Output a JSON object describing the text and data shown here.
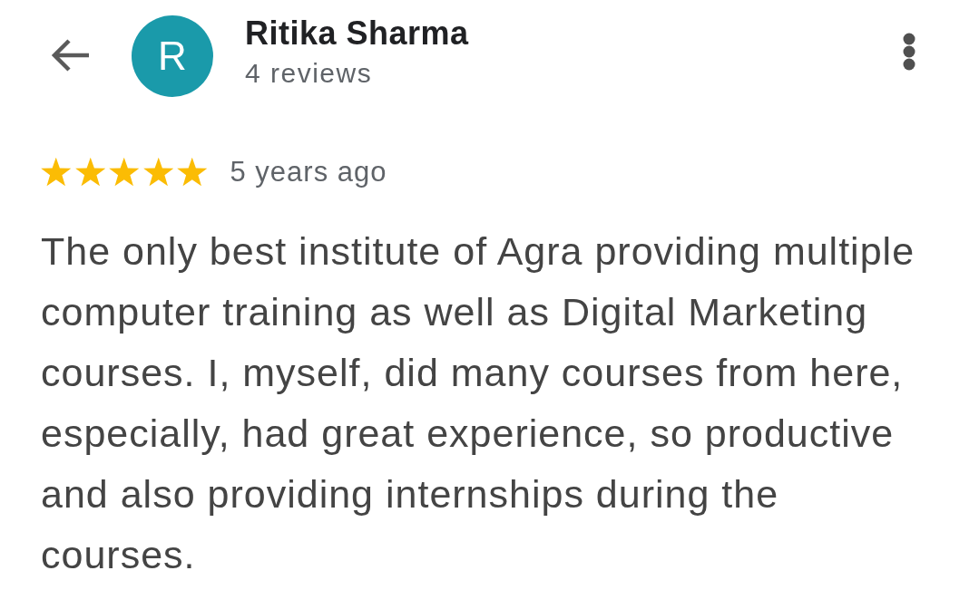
{
  "reviewer": {
    "initial": "R",
    "name": "Ritika Sharma",
    "review_count": "4 reviews"
  },
  "review": {
    "stars": 5,
    "time": "5 years ago",
    "text": "The only best institute of Agra providing multiple computer training as well as Digital Marketing courses. I, myself, did many courses from here, especially, had great experience, so productive and also providing internships during the courses."
  }
}
